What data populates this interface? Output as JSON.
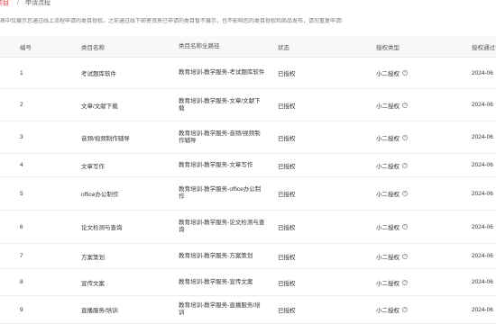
{
  "breadcrumb": {
    "parent": "类目",
    "separator": "/",
    "current": "申请流程"
  },
  "notice": "表中仅展示您通过线上流程申请的类目授权。之前通过线下邮寄资质已申请的类目暂不展示，也不影响您的类目授权和商品发布，请勿重复申请!",
  "table": {
    "headers": {
      "index": "编号",
      "name": "类目名称",
      "path": "类目名称全路径",
      "status": "状态",
      "type": "授权类型",
      "time": "授权通过"
    },
    "rows": [
      {
        "index": "1",
        "name": "考试题库软件",
        "path": "教育培训-教学服务-考试题库软件",
        "status": "已授权",
        "type": "小二授权",
        "time": "2024-06"
      },
      {
        "index": "2",
        "name": "文章/文献下载",
        "path": "教育培训-教学服务-文章/文献下载",
        "status": "已授权",
        "type": "小二授权",
        "time": "2024-06"
      },
      {
        "index": "3",
        "name": "音频/视频制作辅导",
        "path": "教育培训-教学服务-音频/视频制作辅导",
        "status": "已授权",
        "type": "小二授权",
        "time": "2024-06"
      },
      {
        "index": "4",
        "name": "文章写作",
        "path": "教育培训-教学服务-文章写作",
        "status": "已授权",
        "type": "小二授权",
        "time": "2024-06"
      },
      {
        "index": "5",
        "name": "office办公制作",
        "path": "教育培训-教学服务-office办公制作",
        "status": "已授权",
        "type": "小二授权",
        "time": "2024-06"
      },
      {
        "index": "6",
        "name": "论文检测与查询",
        "path": "教育培训-教学服务-论文检测与查询",
        "status": "已授权",
        "type": "小二授权",
        "time": "2024-06"
      },
      {
        "index": "7",
        "name": "方案策划",
        "path": "教育培训-教学服务-方案策划",
        "status": "已授权",
        "type": "小二授权",
        "time": "2024-06"
      },
      {
        "index": "8",
        "name": "宣传文案",
        "path": "教育培训-教学服务-宣传文案",
        "status": "已授权",
        "type": "小二授权",
        "time": "2024-06"
      },
      {
        "index": "9",
        "name": "直播服务/培训",
        "path": "教育培训-教学服务-直播服务/培训",
        "status": "已授权",
        "type": "小二授权",
        "time": "2024-06"
      }
    ]
  },
  "icons": {
    "help": "question-circle-icon"
  },
  "colors": {
    "breadcrumb_link": "#e03131",
    "header_bg": "#f7f8fa",
    "divider": "#ececec"
  }
}
